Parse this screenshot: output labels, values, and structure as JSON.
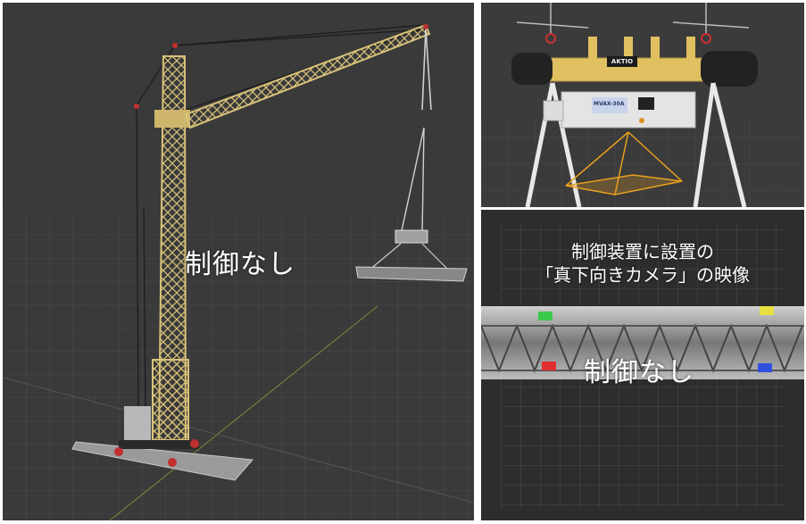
{
  "panels": {
    "left": {
      "label": "制御なし",
      "background": "#3a3a3a",
      "crane_color": "#d9c27a"
    },
    "top_right": {
      "plate_label": "AKTIO",
      "box_label": "MVAX-30A",
      "yellow_color": "#e0c060"
    },
    "bottom_right": {
      "caption_line1": "制御装置に設置の",
      "caption_line2": "「真下向きカメラ」の映像",
      "label": "制御なし",
      "marker_colors": [
        "#3cc84a",
        "#e8e040",
        "#e03030",
        "#3050e0"
      ]
    }
  }
}
